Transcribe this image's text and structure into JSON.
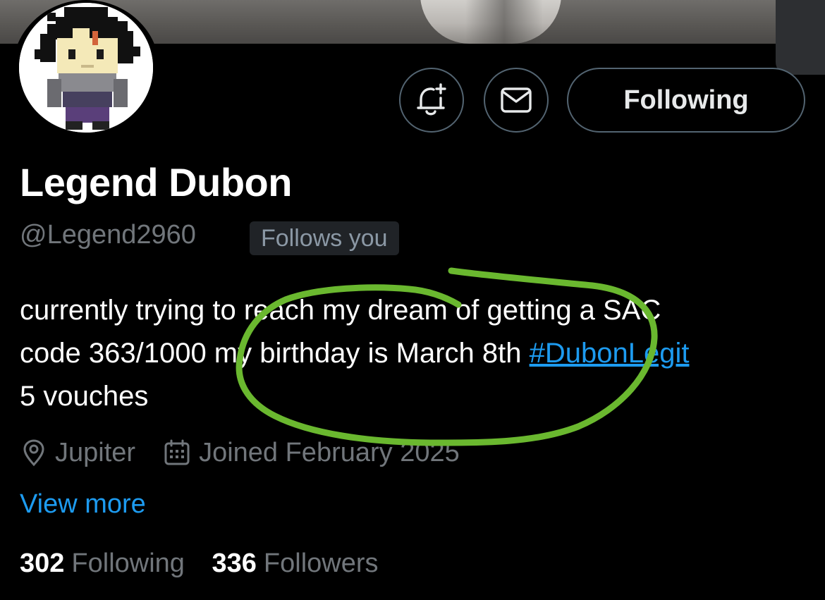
{
  "profile": {
    "name": "Legend Dubon",
    "handle": "@Legend2960",
    "follows_you_badge": "Follows you",
    "bio": {
      "text_line1": "currently trying to reach my dream of getting a SAC",
      "text_line2_prefix": "code 363/1000 my birthday is March 8th ",
      "hashtag": "#DubonLegit",
      "text_line3": "5 vouches"
    },
    "location": "Jupiter",
    "joined": "Joined February 2025",
    "view_more": "View more",
    "following_count": "302",
    "following_label": "Following",
    "followers_count": "336",
    "followers_label": "Followers"
  },
  "actions": {
    "notifications_icon": "bell-plus-icon",
    "message_icon": "envelope-icon",
    "following_button_label": "Following"
  },
  "colors": {
    "background": "#000000",
    "primary_text": "#e7e9ea",
    "secondary_text": "#71767b",
    "link": "#1d9bf0",
    "border": "#536471",
    "annotation": "#6ab82f"
  }
}
